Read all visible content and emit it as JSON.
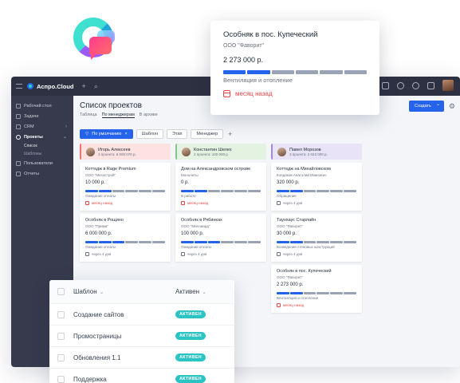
{
  "app": {
    "brand": "Аспро.Cloud",
    "topbar": {
      "plus": "+",
      "search": "⌕"
    }
  },
  "sidebar": {
    "items": [
      {
        "label": "Рабочий стол",
        "active": false
      },
      {
        "label": "Задачи",
        "active": false
      },
      {
        "label": "CRM",
        "active": false,
        "chevron": "›"
      },
      {
        "label": "Проекты",
        "active": true,
        "chevron": "⌄"
      },
      {
        "label": "Пользователи",
        "active": false
      },
      {
        "label": "Отчеты",
        "active": false
      }
    ],
    "sub_items": [
      {
        "label": "Список",
        "active": true
      },
      {
        "label": "Шаблоны",
        "active": false
      }
    ]
  },
  "main": {
    "title": "Список проектов",
    "view_tabs": [
      "Таблица",
      "По менеджерам",
      "В архиве"
    ],
    "active_view_tab": 1,
    "create_label": "Создать",
    "filters": {
      "default_chip": "По умолчанию",
      "chips": [
        "Шаблон",
        "Этап",
        "Менеджер"
      ],
      "add": "+"
    }
  },
  "columns": [
    {
      "manager": "Игорь Алексеев",
      "meta": "3 проекта: 6 000 070 р.",
      "head_color": "#fde2e2",
      "head_border": "#f87171",
      "cards": [
        {
          "title": "Коттедж в Rage Premium",
          "company": "ООО \"МегаСтрой\"",
          "sum": "10 000 р.",
          "filled": 2,
          "stage": "Ожидание оплаты",
          "date": "месяц назад",
          "overdue": true
        },
        {
          "title": "Особняк в Рощино",
          "company": "ООО \"Прима\"",
          "sum": "6 000 000 р.",
          "filled": 3,
          "stage": "Ожидание оплаты",
          "date": "через 4 дня",
          "overdue": false
        }
      ]
    },
    {
      "manager": "Константин Шелех",
      "meta": "2 проекта: 100 000 р.",
      "head_color": "#e3f2e1",
      "head_border": "#86c58a",
      "cards": [
        {
          "title": "Дом на Александровском острове",
          "company": "Монолиты",
          "sum": "0 р.",
          "filled": 2,
          "stage": "В работе",
          "date": "месяц назад",
          "overdue": true
        },
        {
          "title": "Особняк в Рябинках",
          "company": "ООО \"Миллиард\"",
          "sum": "100 000 р.",
          "filled": 3,
          "stage": "Ожидание оплаты",
          "date": "через 4 дня",
          "overdue": false
        }
      ]
    },
    {
      "manager": "Павел Морозов",
      "meta": "3 проекта: 2 023 000 р.",
      "head_color": "#e8e3f7",
      "head_border": "#a38bd8",
      "cards": [
        {
          "title": "Коттедж на Михайловском",
          "company": "Кондаков Анатолий Иванович",
          "sum": "320 000 р.",
          "filled": 2,
          "stage": "Обращение",
          "date": "через 4 дня",
          "overdue": false
        },
        {
          "title": "Таунхаус Старлайн",
          "company": "ООО \"Фаворит\"",
          "sum": "30 000 р.",
          "filled": 2,
          "stage": "Возведение стеновых конструкций",
          "date": "через 4 дня",
          "overdue": false
        },
        {
          "title": "Особняк в пос. Купеческий",
          "company": "ООО \"Фаворит\"",
          "sum": "2 273 000 р.",
          "filled": 2,
          "stage": "Вентиляция и отопление",
          "date": "месяц назад",
          "overdue": true
        }
      ]
    }
  ],
  "popup": {
    "title": "Особняк в пос. Купеческий",
    "company": "ООО \"Фаворит\"",
    "sum": "2 273 000 р.",
    "stages_total": 6,
    "stages_filled": 2,
    "stage": "Вентиляция и отопление",
    "date": "месяц назад"
  },
  "templates": {
    "header": {
      "name": "Шаблон",
      "status": "Активен",
      "caret": "⌄"
    },
    "rows": [
      {
        "name": "Создание сайтов",
        "status": "АКТИВЕН"
      },
      {
        "name": "Промостраницы",
        "status": "АКТИВЕН"
      },
      {
        "name": "Обновления 1.1",
        "status": "АКТИВЕН"
      },
      {
        "name": "Поддержка",
        "status": "АКТИВЕН"
      }
    ]
  }
}
